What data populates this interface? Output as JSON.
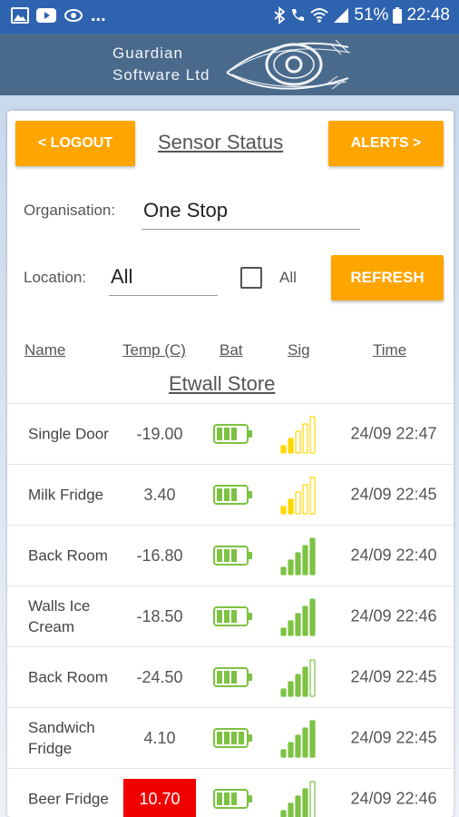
{
  "statusbar": {
    "dots": "...",
    "battery": "51%",
    "time": "22:48"
  },
  "banner": {
    "company_line1": "Guardian",
    "company_line2": "Software Ltd"
  },
  "header": {
    "logout_label": "< LOGOUT",
    "title": "Sensor Status",
    "alerts_label": "ALERTS >"
  },
  "filters": {
    "organisation_label": "Organisation:",
    "organisation_value": "One Stop",
    "location_label": "Location:",
    "location_value": "All",
    "all_checkbox_label": "All",
    "all_checked": false,
    "refresh_label": "REFRESH"
  },
  "table": {
    "headers": {
      "name": "Name",
      "temp": "Temp (C)",
      "bat": "Bat",
      "sig": "Sig",
      "time": "Time"
    },
    "group": "Etwall Store",
    "rows": [
      {
        "name": "Single Door",
        "temp": "-19.00",
        "alarm": false,
        "battery_level": 0.75,
        "signal_bars": 2,
        "signal_color": "#ffd700",
        "time": "24/09 22:47"
      },
      {
        "name": "Milk Fridge",
        "temp": "3.40",
        "alarm": false,
        "battery_level": 0.75,
        "signal_bars": 2,
        "signal_color": "#ffd700",
        "time": "24/09 22:45"
      },
      {
        "name": "Back Room",
        "temp": "-16.80",
        "alarm": false,
        "battery_level": 0.75,
        "signal_bars": 5,
        "signal_color": "#7dc242",
        "time": "24/09 22:40"
      },
      {
        "name": "Walls Ice Cream",
        "temp": "-18.50",
        "alarm": false,
        "battery_level": 0.75,
        "signal_bars": 5,
        "signal_color": "#7dc242",
        "time": "24/09 22:46"
      },
      {
        "name": "Back Room",
        "temp": "-24.50",
        "alarm": false,
        "battery_level": 0.75,
        "signal_bars": 4,
        "signal_color": "#7dc242",
        "time": "24/09 22:45"
      },
      {
        "name": "Sandwich Fridge",
        "temp": "4.10",
        "alarm": false,
        "battery_level": 1.0,
        "signal_bars": 5,
        "signal_color": "#7dc242",
        "time": "24/09 22:45"
      },
      {
        "name": "Beer Fridge",
        "temp": "10.70",
        "alarm": true,
        "battery_level": 0.75,
        "signal_bars": 4,
        "signal_color": "#7dc242",
        "time": "24/09 22:46"
      }
    ]
  },
  "colors": {
    "accent": "#ffa500",
    "alarm": "#f20000",
    "battery": "#7dc242",
    "banner": "#4a6a8c",
    "statusbar": "#2e63b0"
  }
}
